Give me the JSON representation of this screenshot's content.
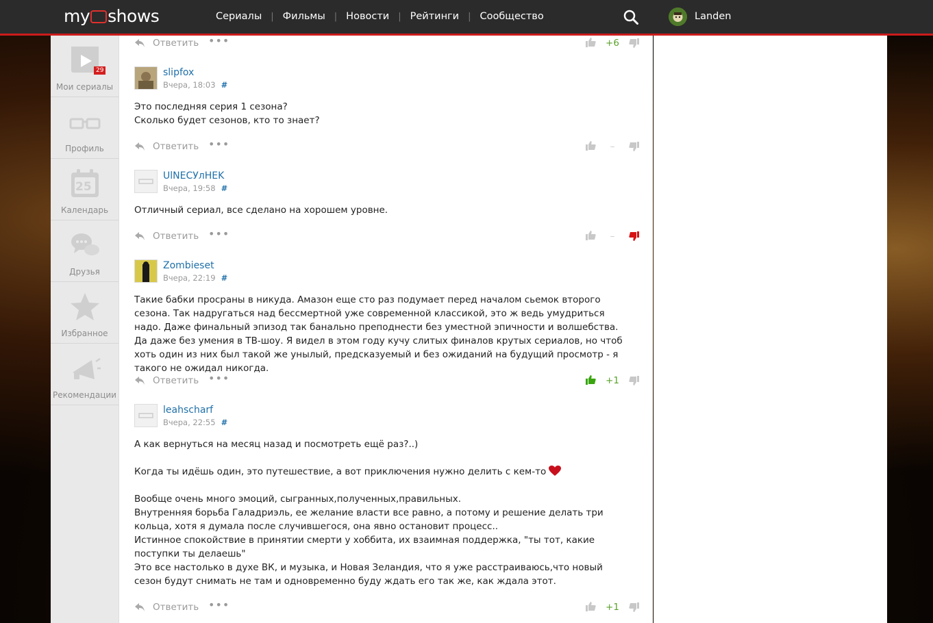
{
  "brand": {
    "logo_left": "my",
    "logo_right": "shows"
  },
  "nav": [
    {
      "label": "Сериалы"
    },
    {
      "label": "Фильмы"
    },
    {
      "label": "Новости"
    },
    {
      "label": "Рейтинги"
    },
    {
      "label": "Сообщество"
    }
  ],
  "user": {
    "name": "Landen"
  },
  "sidebar": {
    "items": [
      {
        "label": "Мои сериалы",
        "badge": "29",
        "icon": "tv-play-icon"
      },
      {
        "label": "Профиль",
        "icon": "glasses-icon"
      },
      {
        "label": "Календарь",
        "day": "25",
        "icon": "calendar-icon"
      },
      {
        "label": "Друзья",
        "icon": "chat-bubbles-icon"
      },
      {
        "label": "Избранное",
        "icon": "star-icon"
      },
      {
        "label": "Рекомендации",
        "icon": "megaphone-icon"
      }
    ]
  },
  "reply_label": "Ответить",
  "more_label": "•••",
  "comments": [
    {
      "author": "",
      "time": "",
      "text": "",
      "score": "+6",
      "score_state": "positive"
    },
    {
      "author": "slipfox",
      "time": "Вчера, 18:03",
      "hash": "#",
      "text": "Это последняя серия 1 сезона?\nСколько будет сезонов, кто то знает?",
      "score": "–",
      "score_state": "zero"
    },
    {
      "author": "UlNECУлHEK",
      "time": "Вчера, 19:58",
      "hash": "#",
      "text": "Отличный сериал, все сделано на хорошем уровне.",
      "score": "–",
      "score_state": "disliked"
    },
    {
      "author": "Zombieset",
      "time": "Вчера, 22:19",
      "hash": "#",
      "text": "Такие бабки просраны в никуда. Амазон еще сто раз подумает перед началом сьемок второго сезона. Так надругаться над бессмертной уже современной классикой, это ж ведь умудриться надо. Даже финальный эпизод так банально преподнести без уместной эпичности и волшебства. Да даже без умения в ТВ-шоу. Я видел в этом году кучу слитых финалов крутых сериалов, но чтоб хоть один из них был такой же унылый, предсказуемый и без ожиданий на будущий просмотр - я такого не ожидал никогда.",
      "score": "+1",
      "score_state": "liked"
    },
    {
      "author": "leahscharf",
      "time": "Вчера, 22:55",
      "hash": "#",
      "text_lines": [
        "А как вернуться на месяц назад и посмотреть ещё раз?..)",
        "",
        "Когда ты идёшь один, это путешествие, а вот приключения нужно делить с кем-то",
        "",
        "Вообще очень много эмоций, сыгранных,полученных,правильных.",
        "Внутренняя борьба Галадриэль, ее желание власти все равно, а потому и решение делать три кольца, хотя я думала после случившегося, она явно остановит процесс..",
        "Истинное спокойствие в принятии смерти у хоббита, их взаимная поддержка, \"ты тот, какие поступки ты делаешь\"",
        "Это все настолько в духе ВК, и музыка, и Новая Зеландия, что я уже расстраиваюсь,что новый сезон будут снимать не там и одновременно буду ждать его так же, как ждала этот."
      ],
      "score": "+1",
      "score_state": "positive"
    }
  ],
  "colors": {
    "accent_red": "#cc1b1b",
    "link_blue": "#1f6fa8",
    "score_green": "#5aa12a",
    "topbar": "#2b2b2b"
  }
}
